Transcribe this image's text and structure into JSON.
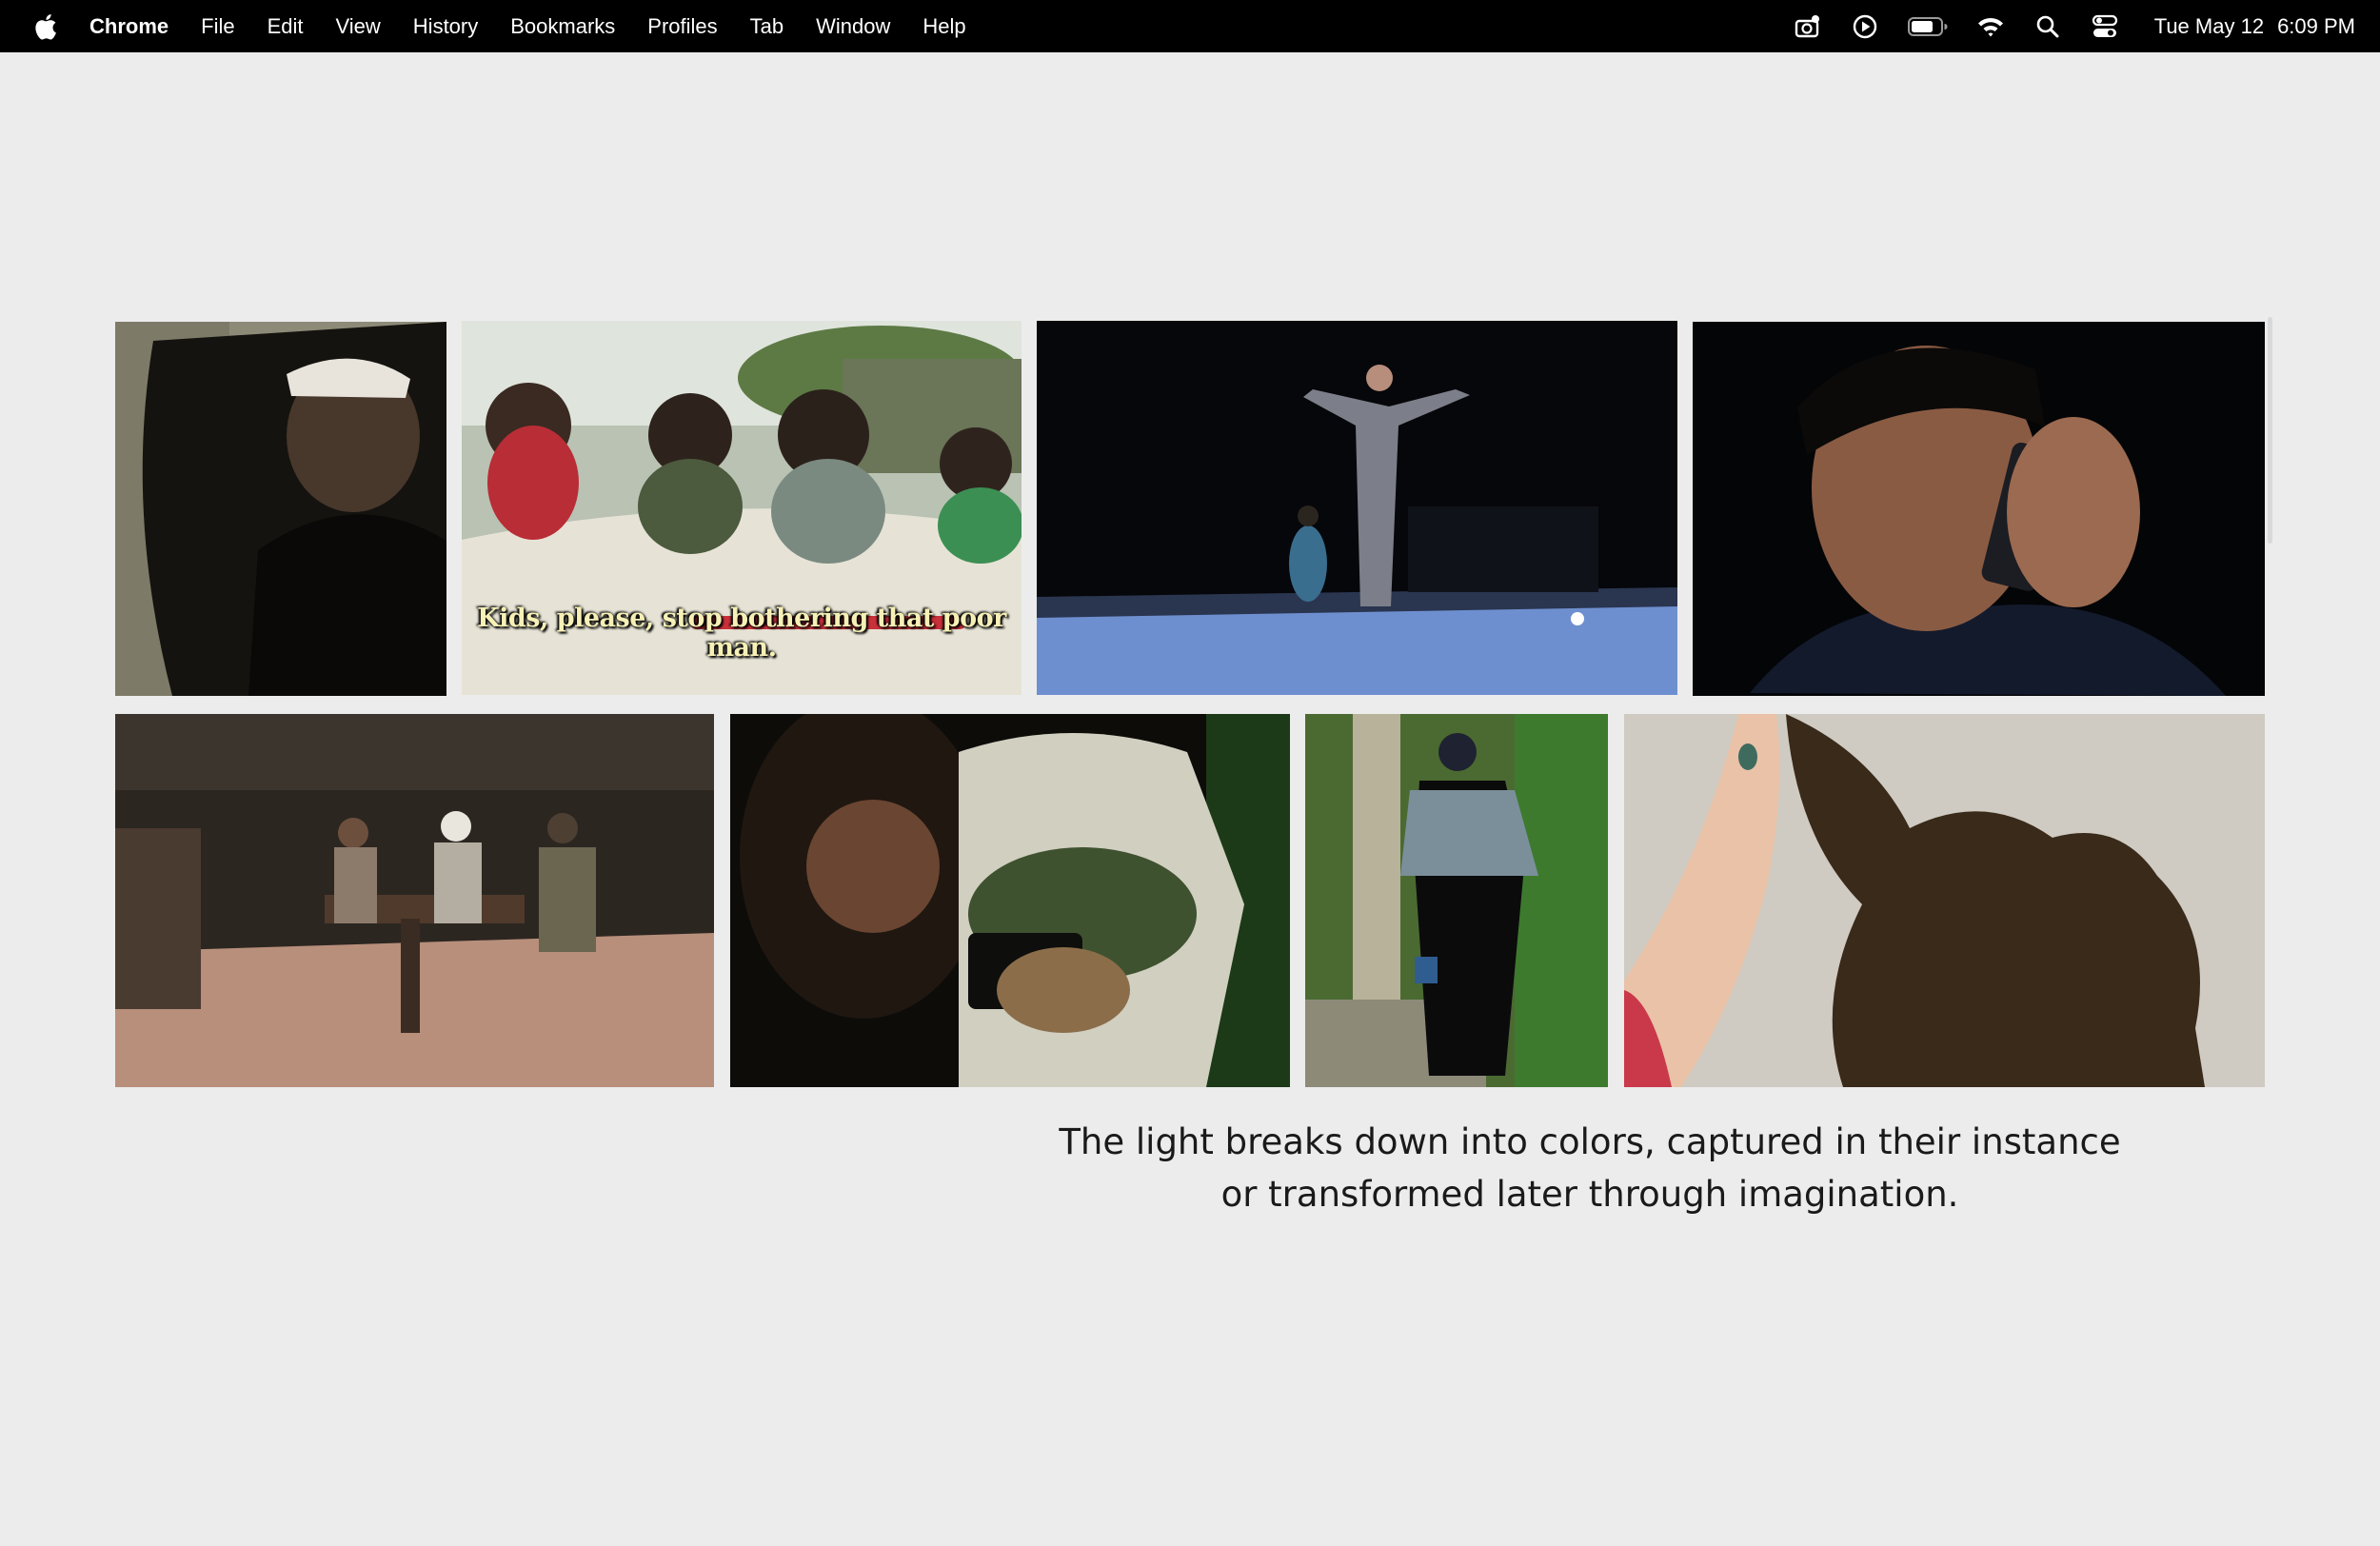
{
  "menubar": {
    "app_name": "Chrome",
    "menus": [
      "File",
      "Edit",
      "View",
      "History",
      "Bookmarks",
      "Profiles",
      "Tab",
      "Window",
      "Help"
    ],
    "status_icons": [
      "screen-recorder-icon",
      "media-play-icon",
      "battery-icon",
      "wifi-icon",
      "spotlight-search-icon",
      "control-center-icon"
    ],
    "date": "Tue May 12",
    "time": "6:09 PM"
  },
  "gallery": {
    "stills": [
      {
        "name": "still-man-in-mirror",
        "icon": "man-in-car-mirror"
      },
      {
        "name": "still-kids-in-convertible",
        "icon": "children-in-white-convertible",
        "subtitle": "Kids, please, stop bothering that poor man."
      },
      {
        "name": "still-night-rooftop",
        "icon": "man-with-arms-outstretched-at-night"
      },
      {
        "name": "still-man-on-phone",
        "icon": "man-talking-on-phone"
      },
      {
        "name": "still-diner-table",
        "icon": "three-men-at-diner-table"
      },
      {
        "name": "still-boy-with-camera",
        "icon": "boy-holding-camera"
      },
      {
        "name": "still-woman-with-bucket",
        "icon": "woman-with-bucket"
      },
      {
        "name": "still-hand-and-shadow",
        "icon": "hand-reaching-toward-shadow"
      }
    ]
  },
  "caption": {
    "line1": "The light breaks down into colors, captured in their instance",
    "line2": "or transformed later through imagination."
  },
  "colors": {
    "page_background": "#ececec",
    "menubar_background": "#000000",
    "caption_text": "#1a1a1a",
    "subtitle_text": "#f6f0b6"
  }
}
